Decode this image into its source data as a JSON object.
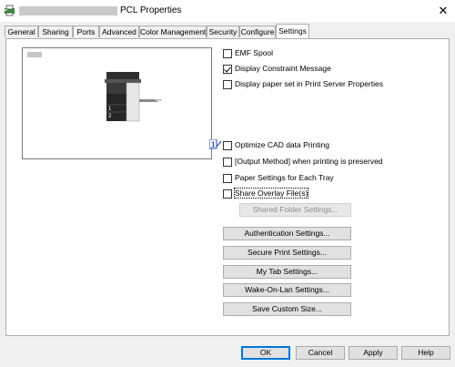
{
  "window": {
    "title": "PCL Properties",
    "icon": "printer-app-icon",
    "close_symbol": "✕"
  },
  "tabs": [
    {
      "label": "General"
    },
    {
      "label": "Sharing"
    },
    {
      "label": "Ports"
    },
    {
      "label": "Advanced"
    },
    {
      "label": "Color Management"
    },
    {
      "label": "Security"
    },
    {
      "label": "Configure"
    },
    {
      "label": "Settings",
      "active": true
    }
  ],
  "preview": {
    "icon": "printer-device-icon",
    "tray_numbers": [
      "1",
      "2"
    ]
  },
  "options_top": [
    {
      "label": "EMF Spool",
      "checked": false
    },
    {
      "label": "Display Constraint Message",
      "checked": true
    },
    {
      "label": "Display paper set in Print Server Properties",
      "checked": false
    }
  ],
  "info_badge": "1",
  "options_bottom": [
    {
      "label": "Optimize CAD data Printing",
      "checked": false
    },
    {
      "label": "[Output Method] when printing is preserved",
      "checked": false
    },
    {
      "label": "Paper Settings for Each Tray",
      "checked": false
    },
    {
      "label": "Share Overlay File(s)",
      "checked": false
    }
  ],
  "buttons": {
    "shared_folder": "Shared Folder Settings...",
    "authentication": "Authentication Settings...",
    "secure_print": "Secure Print Settings...",
    "my_tab": "My Tab Settings...",
    "wake_on_lan": "Wake-On-Lan Settings...",
    "save_custom_size": "Save Custom Size..."
  },
  "dialog_buttons": {
    "ok": "OK",
    "cancel": "Cancel",
    "apply": "Apply",
    "help": "Help"
  },
  "colors": {
    "window_bg": "#f0f0f0",
    "panel_bg": "#ffffff",
    "default_button_border": "#0078d7",
    "info_badge": "#2b4fa8"
  }
}
